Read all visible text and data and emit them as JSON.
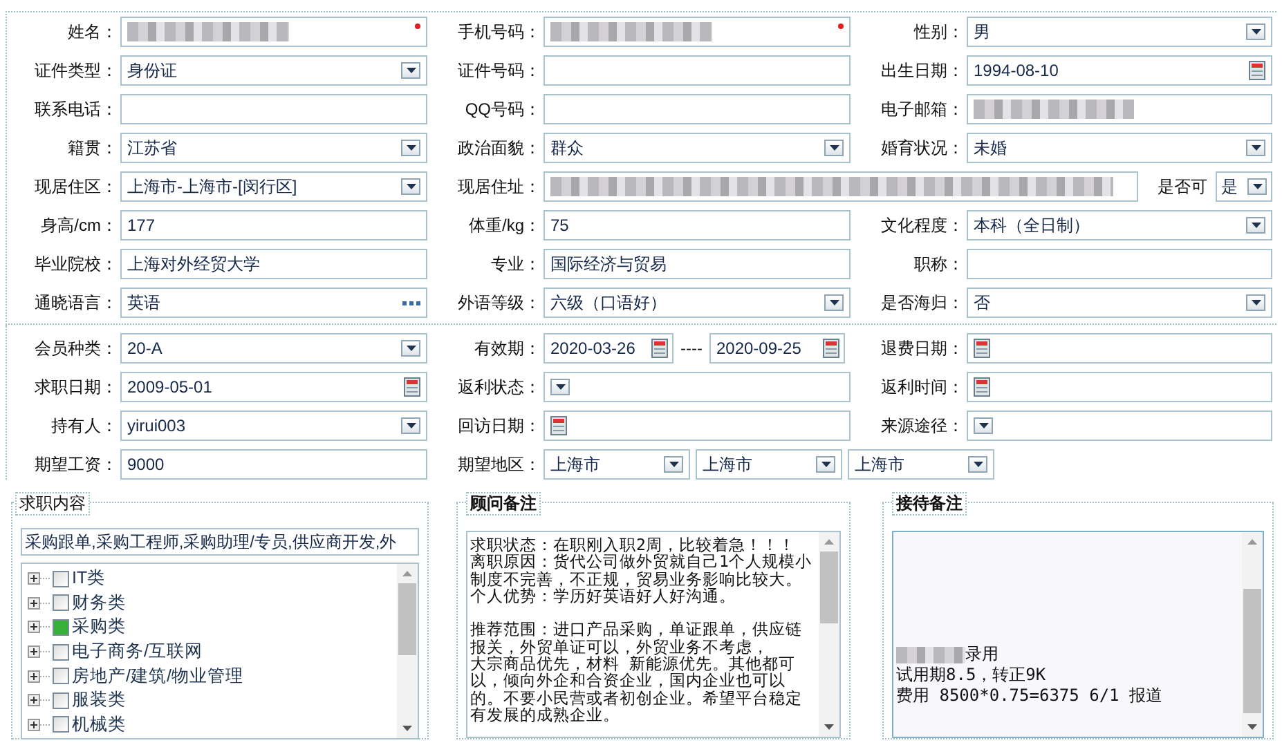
{
  "profile": {
    "rows": [
      [
        {
          "label": "姓名：",
          "kind": "masked",
          "required": true
        },
        {
          "label": "手机号码：",
          "kind": "masked",
          "required": true
        },
        {
          "label": "性别：",
          "kind": "select",
          "value": "男",
          "required": false
        }
      ],
      [
        {
          "label": "证件类型：",
          "kind": "select",
          "value": "身份证",
          "required": false
        },
        {
          "label": "证件号码：",
          "kind": "text",
          "required": false
        },
        {
          "label": "出生日期：",
          "kind": "date",
          "value": "1994-08-10",
          "required": false
        }
      ],
      [
        {
          "label": "联系电话：",
          "kind": "text",
          "required": false
        },
        {
          "label": "QQ号码：",
          "kind": "text",
          "required": false
        },
        {
          "label": "电子邮箱：",
          "kind": "masked",
          "required": false
        }
      ],
      [
        {
          "label": "籍贯：",
          "kind": "select",
          "value": "江苏省",
          "required": false
        },
        {
          "label": "政治面貌：",
          "kind": "select",
          "value": "群众",
          "required": false
        },
        {
          "label": "婚育状况：",
          "kind": "select",
          "value": "未婚",
          "required": false
        }
      ],
      [
        {
          "label": "现居住区：",
          "kind": "select",
          "value": "上海市-上海市-[闵行区]",
          "required": false
        },
        {
          "label": "现居住址：",
          "kind": "masked",
          "required": false,
          "attached": {
            "label": "是否可",
            "value": "是"
          }
        }
      ],
      [
        {
          "label": "身高/cm：",
          "kind": "text",
          "value": "177",
          "required": false
        },
        {
          "label": "体重/kg：",
          "kind": "text",
          "value": "75",
          "required": false
        },
        {
          "label": "文化程度：",
          "kind": "select",
          "value": "本科（全日制）",
          "required": false
        }
      ],
      [
        {
          "label": "毕业院校：",
          "kind": "text",
          "value": "上海对外经贸大学",
          "required": false
        },
        {
          "label": "专业：",
          "kind": "text",
          "value": "国际经济与贸易",
          "required": false
        },
        {
          "label": "职称：",
          "kind": "text",
          "required": false
        }
      ],
      [
        {
          "label": "通晓语言：",
          "kind": "more",
          "value": "英语",
          "required": false
        },
        {
          "label": "外语等级：",
          "kind": "select",
          "value": "六级（口语好）",
          "required": false
        },
        {
          "label": "是否海归：",
          "kind": "select",
          "value": "否",
          "required": false
        }
      ]
    ]
  },
  "membership": {
    "rows": [
      [
        {
          "label": "会员种类：",
          "kind": "select",
          "value": "20-A",
          "required": false
        },
        {
          "label": "有效期：",
          "kind": "date-range",
          "values": [
            "2020-03-26",
            "2020-09-25"
          ],
          "separator": "----",
          "required": false
        },
        {
          "label": "退费日期：",
          "kind": "date",
          "required": false
        }
      ],
      [
        {
          "label": "求职日期：",
          "kind": "date",
          "value": "2009-05-01",
          "required": false
        },
        {
          "label": "返利状态：",
          "kind": "select",
          "required": false
        },
        {
          "label": "返利时间：",
          "kind": "date",
          "required": false
        }
      ],
      [
        {
          "label": "持有人：",
          "kind": "select",
          "value": "yirui003",
          "required": false
        },
        {
          "label": "回访日期：",
          "kind": "date",
          "required": false
        },
        {
          "label": "来源途径：",
          "kind": "select",
          "required": false
        }
      ],
      [
        {
          "label": "期望工资：",
          "kind": "text",
          "value": "9000",
          "required": false
        },
        {
          "label": "期望地区：",
          "kind": "multi-select",
          "values": [
            "上海市",
            "上海市",
            "上海市"
          ],
          "required": false
        }
      ]
    ]
  },
  "job_content": {
    "legend": "求职内容",
    "value": "采购跟单,采购工程师,采购助理/专员,供应商开发,外",
    "tree": [
      {
        "label": "IT类",
        "checked": false
      },
      {
        "label": "财务类",
        "checked": false
      },
      {
        "label": "采购类",
        "checked": true
      },
      {
        "label": "电子商务/互联网",
        "checked": false
      },
      {
        "label": "房地产/建筑/物业管理",
        "checked": false
      },
      {
        "label": "服装类",
        "checked": false
      },
      {
        "label": "机械类",
        "checked": false
      }
    ]
  },
  "consultant_notes": {
    "legend": "顾问备注",
    "paragraphs": [
      [
        "求职状态：在职刚入职2周，比较着急！！！",
        "离职原因：货代公司做外贸就自己1个人规模小",
        "制度不完善，不正规，贸易业务影响比较大。",
        "个人优势：学历好英语好人好沟通。"
      ],
      [
        "推荐范围：进口产品采购，单证跟单，供应链",
        "报关，外贸单证可以，外贸业务不考虑，",
        "大宗商品优先，材料 新能源优先。其他都可",
        "以，倾向外企和合资企业，国内企业也可以",
        "的。不要小民营或者初创企业。希望平台稳定",
        "有发展的成熟企业。"
      ]
    ]
  },
  "reception_notes": {
    "legend": "接待备注",
    "lines": [
      {
        "masked": true,
        "text": "录用"
      },
      {
        "masked": false,
        "text": "试用期8.5，转正9K"
      },
      {
        "masked": false,
        "text": "费用 8500*0.75=6375 6/1 报道"
      }
    ]
  }
}
